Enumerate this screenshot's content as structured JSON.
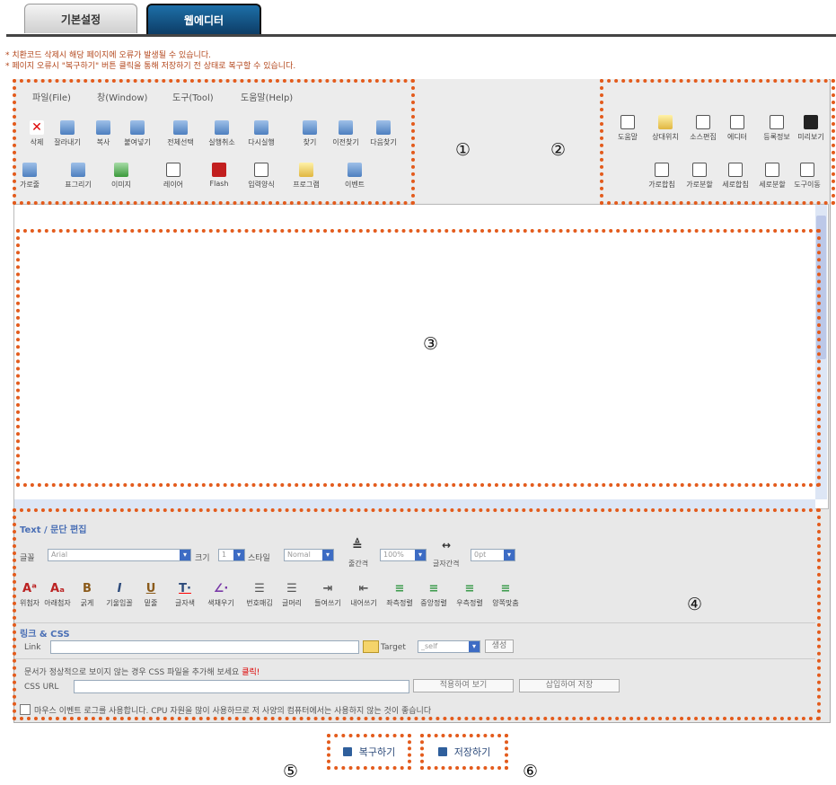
{
  "tabs": [
    {
      "label": "기본설정"
    },
    {
      "label": "웹에디터"
    }
  ],
  "notices": [
    "* 치환코드 삭제시 해당 페이지에 오류가 발생될 수 있습니다.",
    "* 페이지 오류시 \"복구하기\" 버튼 클릭을 통해 저장하기 전 상태로 복구할 수 있습니다."
  ],
  "menu": [
    "파일(File)",
    "창(Window)",
    "도구(Tool)",
    "도움말(Help)"
  ],
  "tools_row1": [
    "삭제",
    "잘라내기",
    "복사",
    "붙여넣기",
    "전체선택",
    "실행취소",
    "다시실행",
    "찾기",
    "이전찾기",
    "다음찾기"
  ],
  "tools_row2": [
    "가로줄",
    "표그리기",
    "이미지",
    "레이어",
    "Flash",
    "입력양식",
    "프로그램",
    "이벤트"
  ],
  "right_row1": [
    "도움말",
    "상대위치",
    "소스편집",
    "에디터",
    "등록정보",
    "미리보기"
  ],
  "right_row2": [
    "가로합침",
    "가로분할",
    "세로합침",
    "세로분할",
    "도구이동"
  ],
  "text_section": {
    "title": "Text / 문단 편집",
    "font_label": "글꼴",
    "font_value": "Arial",
    "size_label": "크기",
    "size_value": "1",
    "style_label": "스타일",
    "style_value": "Nomal",
    "line_spacing_label": "줄간격",
    "line_spacing_value": "100%",
    "letter_spacing_label": "글자간격",
    "letter_spacing_value": "0pt"
  },
  "format_buttons": [
    "위첨자",
    "아래첨자",
    "굵게",
    "기울임꼴",
    "밑줄",
    "글자색",
    "색채우기",
    "번호매김",
    "글머리",
    "들여쓰기",
    "내어쓰기",
    "좌측정렬",
    "중앙정렬",
    "우측정렬",
    "양쪽맞춤"
  ],
  "link_section": {
    "title": "링크 & CSS",
    "link_label": "Link",
    "target_label": "Target",
    "target_value": "_self",
    "create_button": "생성"
  },
  "css_section": {
    "notice": "문서가 정상적으로 보이지 않는 경우 CSS 파일을 추가해 보세요",
    "notice_link": "클릭!",
    "url_label": "CSS URL",
    "apply_button": "적용하여 보기",
    "insert_button": "삽입하여 저장"
  },
  "mouse_event_text": "마우스 이벤트 로그를 사용합니다. CPU 자원을 많이 사용하므로 저 사양의 컴퓨터에서는 사용하지 않는 것이 좋습니다",
  "restore_button": "복구하기",
  "save_button": "저장하기",
  "markers": [
    "①",
    "②",
    "③",
    "④",
    "⑤",
    "⑥"
  ],
  "colors": {
    "accent": "#e35b1c",
    "tab_active": "#0d3d66",
    "section_title": "#4a6fb5"
  }
}
